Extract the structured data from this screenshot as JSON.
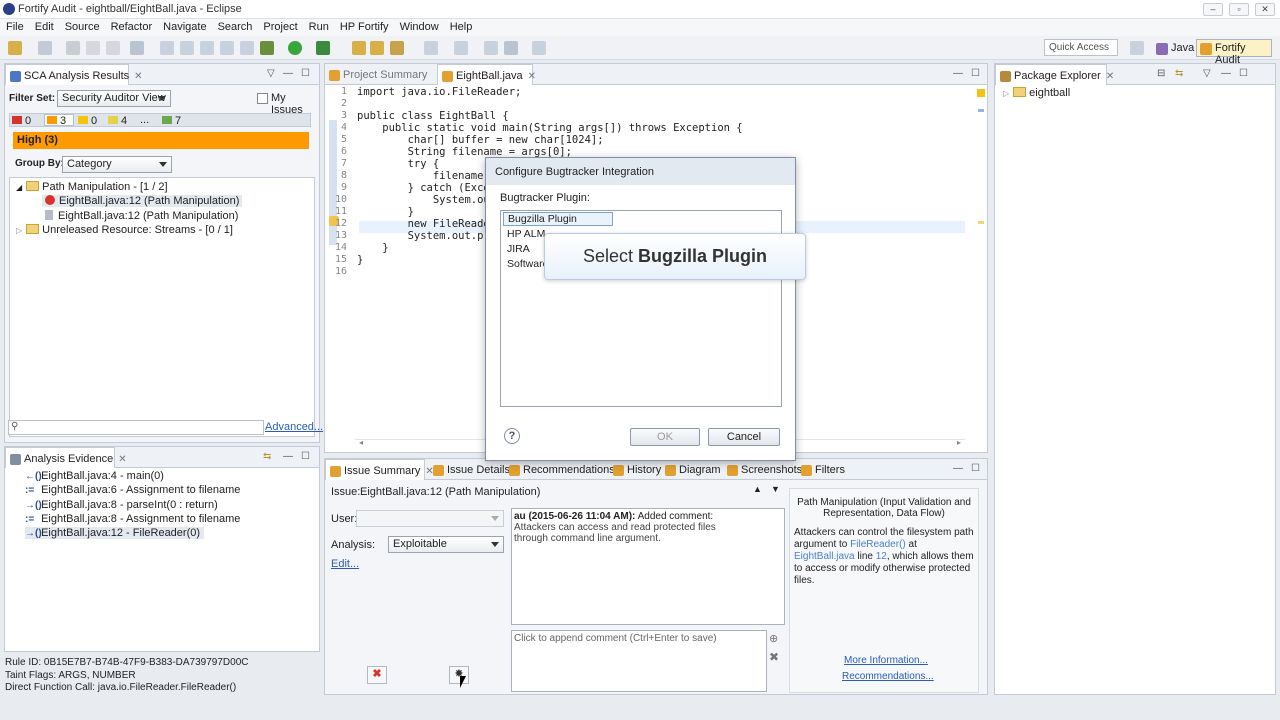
{
  "window": {
    "title": "Fortify Audit - eightball/EightBall.java - Eclipse"
  },
  "menu": [
    "File",
    "Edit",
    "Source",
    "Refactor",
    "Navigate",
    "Search",
    "Project",
    "Run",
    "HP Fortify",
    "Window",
    "Help"
  ],
  "toolbar": {
    "quick_access": "Quick Access",
    "perspective_java": "Java",
    "perspective_fortify": "Fortify Audit"
  },
  "sca": {
    "tab_label": "SCA Analysis Results",
    "filter_label": "Filter Set:",
    "filter_value": "Security Auditor View",
    "my_issues": "My Issues",
    "counts": [
      "0",
      "3",
      "0",
      "4",
      "...",
      "7"
    ],
    "severity_header": "High (3)",
    "group_by_label": "Group By:",
    "group_by_value": "Category",
    "tree": {
      "group1": "Path Manipulation - [1 / 2]",
      "item1": "EightBall.java:12 (Path Manipulation)",
      "item2": "EightBall.java:12 (Path Manipulation)",
      "group2": "Unreleased Resource: Streams - [0 / 1]"
    },
    "search_placeholder": "",
    "advanced": "Advanced..."
  },
  "evidence": {
    "tab_label": "Analysis Evidence",
    "rows": [
      {
        "icon": "←()",
        "text": "EightBall.java:4 - main(0)"
      },
      {
        "icon": ":=",
        "text": "EightBall.java:6 - Assignment to filename"
      },
      {
        "icon": "→()",
        "text": "EightBall.java:8 - parseInt(0 : return)"
      },
      {
        "icon": ":=",
        "text": "EightBall.java:8 - Assignment to filename"
      },
      {
        "icon": "→()",
        "text": "EightBall.java:12 - FileReader(0)"
      }
    ],
    "rule_id": "Rule ID: 0B15E7B7-B74B-47F9-B383-DA739797D00C",
    "taint_flags": "Taint Flags: ARGS, NUMBER",
    "direct_call": "Direct Function Call: java.io.FileReader.FileReader()"
  },
  "editor": {
    "tab_summary": "Project Summary",
    "tab_file": "EightBall.java",
    "line_numbers": [
      "1",
      "2",
      "3",
      "4",
      "5",
      "6",
      "7",
      "8",
      "9",
      "10",
      "11",
      "12",
      "13",
      "14",
      "15",
      "16"
    ],
    "lines": [
      "import java.io.FileReader;",
      "",
      "public class EightBall {",
      "    public static void main(String args[]) throws Exception {",
      "        char[] buffer = new char[1024];",
      "        String filename = args[0];",
      "        try {",
      "            filename =",
      "        } catch (Except",
      "            System.out.",
      "        }",
      "        new FileReader(",
      "        System.out.prin",
      "    }",
      "}",
      ""
    ]
  },
  "package_explorer": {
    "tab_label": "Package Explorer",
    "project": "eightball"
  },
  "bottom": {
    "tabs": [
      "Issue Summary",
      "Issue Details",
      "Recommendations",
      "History",
      "Diagram",
      "Screenshots",
      "Filters"
    ],
    "issue_label": "Issue:",
    "issue_value": "EightBall.java:12 (Path Manipulation)",
    "user_label": "User:",
    "user_value": "",
    "analysis_label": "Analysis:",
    "analysis_value": "Exploitable",
    "edit_link": "Edit...",
    "comment_author": "au (2015-06-26 11:04 AM):",
    "comment_action": "Added comment:",
    "comment_text": "Attackers can access and read protected files through command line argument.",
    "append_placeholder": "Click to append comment (Ctrl+Enter to save)",
    "info_title": "Path Manipulation (Input Validation and Representation, Data Flow)",
    "info_p1": "Attackers can control the filesystem path argument to",
    "info_link1": "FileReader()",
    "info_at": "at",
    "info_link2": "EightBall.java",
    "info_line": "line",
    "info_link3": "12",
    "info_p2": ", which allows them to access or modify otherwise protected files.",
    "more_info": "More Information...",
    "recommendations": "Recommendations..."
  },
  "dialog": {
    "title": "Configure Bugtracker Integration",
    "plugin_label": "Bugtracker Plugin:",
    "plugins": [
      "Bugzilla Plugin",
      "HP ALM",
      "JIRA",
      "Software"
    ],
    "ok": "OK",
    "cancel": "Cancel"
  },
  "callout": {
    "prefix": "Select",
    "emphasis": "Bugzilla Plugin"
  },
  "colors": {
    "high": "#ff9900",
    "critical": "#d9342b",
    "accent": "#fdf1c7"
  }
}
